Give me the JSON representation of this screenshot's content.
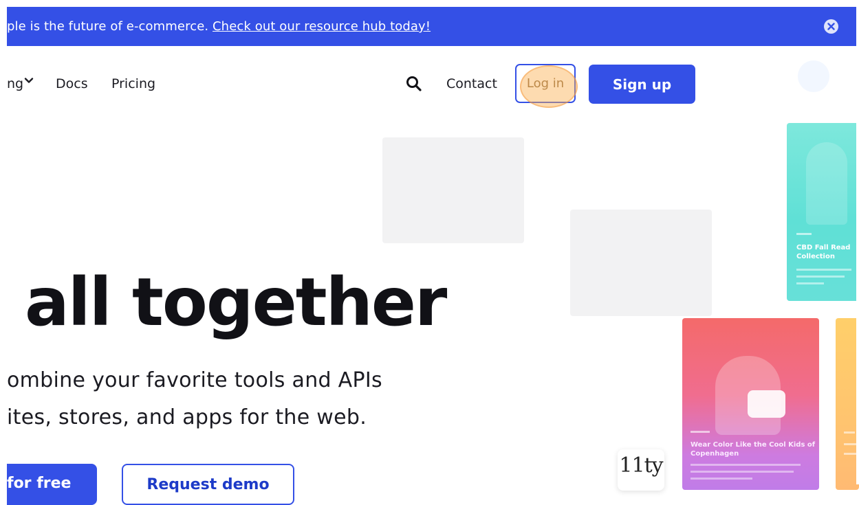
{
  "banner": {
    "text": "ple is the future of e-commerce. ",
    "link_text": "Check out our resource hub today!"
  },
  "nav": {
    "items": [
      {
        "label": "ng"
      },
      {
        "label": "Docs"
      },
      {
        "label": "Pricing"
      }
    ],
    "contact_label": "Contact",
    "login_label": "Log in",
    "signup_label": "Sign up"
  },
  "hero": {
    "title": " all together",
    "subtitle_line1": "ombine your favorite tools and APIs",
    "subtitle_line2": "ites, stores, and apps for the web.",
    "primary_cta": "for free",
    "secondary_cta": "Request demo"
  },
  "showcase": {
    "teal_card_caption": "CBD Fall Read Collection",
    "pink_card_caption": "Wear Color Like the Cool Kids of Copenhagen",
    "eleventy_logo": "11ty"
  },
  "colors": {
    "brand_blue": "#3450e6",
    "banner_text": "#ffffff",
    "click_highlight": "#faaf50"
  },
  "icons": {
    "search": "search-icon",
    "close": "close-circle-icon",
    "chevron": "chevron-down-icon"
  }
}
